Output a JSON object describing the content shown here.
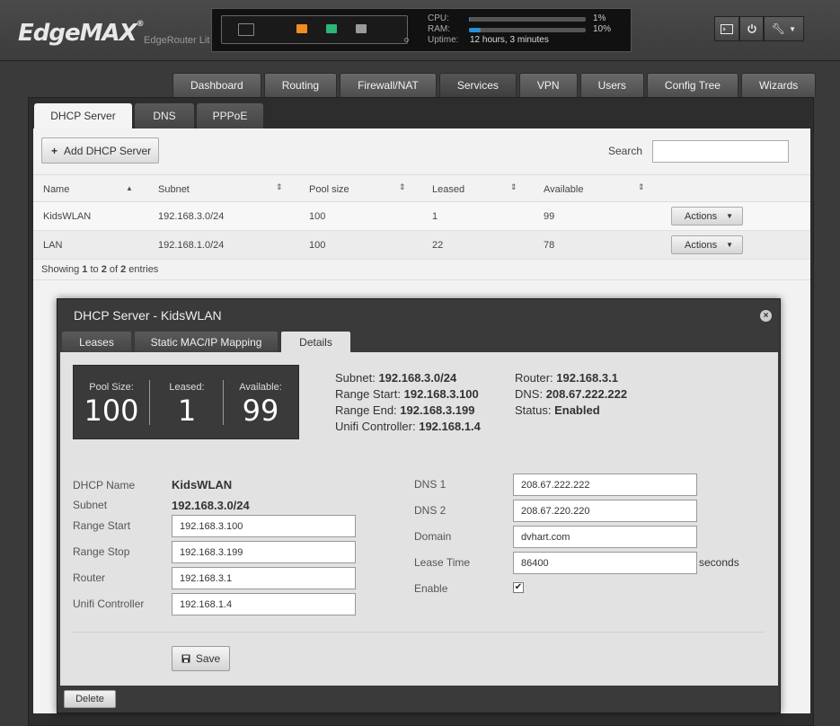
{
  "brand": {
    "logo": "EdgeMAX",
    "logo_mark": "®",
    "product": "EdgeRouter Lite"
  },
  "status": {
    "cpu_label": "CPU:",
    "cpu_value": "1%",
    "cpu_fraction": 0.01,
    "ram_label": "RAM:",
    "ram_value": "10%",
    "ram_fraction": 0.1,
    "uptime_label": "Uptime:",
    "uptime_value": "12 hours, 3 minutes",
    "port_colors": [
      "#f28c1e",
      "#2bb673",
      "#9a9a9a"
    ]
  },
  "topbuttons": {
    "cli_icon": "terminal-icon",
    "power_icon": "power-icon",
    "tools_icon": "wrench-icon"
  },
  "nav": {
    "tabs": [
      "Dashboard",
      "Routing",
      "Firewall/NAT",
      "Services",
      "VPN",
      "Users",
      "Config Tree",
      "Wizards"
    ],
    "active": "Services"
  },
  "subtabs": {
    "items": [
      "DHCP Server",
      "DNS",
      "PPPoE"
    ],
    "active": "DHCP Server"
  },
  "toolbar": {
    "add_label": "Add DHCP Server",
    "search_label": "Search",
    "search_value": ""
  },
  "table": {
    "headers": [
      "Name",
      "Subnet",
      "Pool size",
      "Leased",
      "Available"
    ],
    "rows": [
      {
        "name": "KidsWLAN",
        "subnet": "192.168.3.0/24",
        "pool": "100",
        "leased": "1",
        "available": "99",
        "action": "Actions"
      },
      {
        "name": "LAN",
        "subnet": "192.168.1.0/24",
        "pool": "100",
        "leased": "22",
        "available": "78",
        "action": "Actions"
      }
    ],
    "showing_prefix": "Showing ",
    "showing_from": "1",
    "showing_to_word": " to ",
    "showing_to": "2",
    "showing_of_word": " of ",
    "showing_total": "2",
    "showing_suffix": " entries"
  },
  "dialog": {
    "title": "DHCP Server - KidsWLAN",
    "tabs": [
      "Leases",
      "Static MAC/IP Mapping",
      "Details"
    ],
    "active_tab": "Details",
    "summary": {
      "pool_label": "Pool Size:",
      "pool_value": "100",
      "leased_label": "Leased:",
      "leased_value": "1",
      "available_label": "Available:",
      "available_value": "99"
    },
    "info": {
      "subnet_label": "Subnet:",
      "subnet_value": "192.168.3.0/24",
      "range_start_label": "Range Start:",
      "range_start_value": "192.168.3.100",
      "range_end_label": "Range End:",
      "range_end_value": "192.168.3.199",
      "unifi_label": "Unifi Controller:",
      "unifi_value": "192.168.1.4",
      "router_label": "Router:",
      "router_value": "192.168.3.1",
      "dns_label": "DNS:",
      "dns_value": "208.67.222.222",
      "status_label": "Status:",
      "status_value": "Enabled"
    },
    "form": {
      "dhcp_name_label": "DHCP Name",
      "dhcp_name_value": "KidsWLAN",
      "subnet_label": "Subnet",
      "subnet_value": "192.168.3.0/24",
      "range_start_label": "Range Start",
      "range_start_value": "192.168.3.100",
      "range_stop_label": "Range Stop",
      "range_stop_value": "192.168.3.199",
      "router_label": "Router",
      "router_value": "192.168.3.1",
      "unifi_label": "Unifi Controller",
      "unifi_value": "192.168.1.4",
      "dns1_label": "DNS 1",
      "dns1_value": "208.67.222.222",
      "dns2_label": "DNS 2",
      "dns2_value": "208.67.220.220",
      "domain_label": "Domain",
      "domain_value": "dvhart.com",
      "lease_time_label": "Lease Time",
      "lease_time_value": "86400",
      "lease_time_unit": "seconds",
      "enable_label": "Enable",
      "enable_checked": true
    },
    "save_label": "Save",
    "delete_label": "Delete"
  }
}
